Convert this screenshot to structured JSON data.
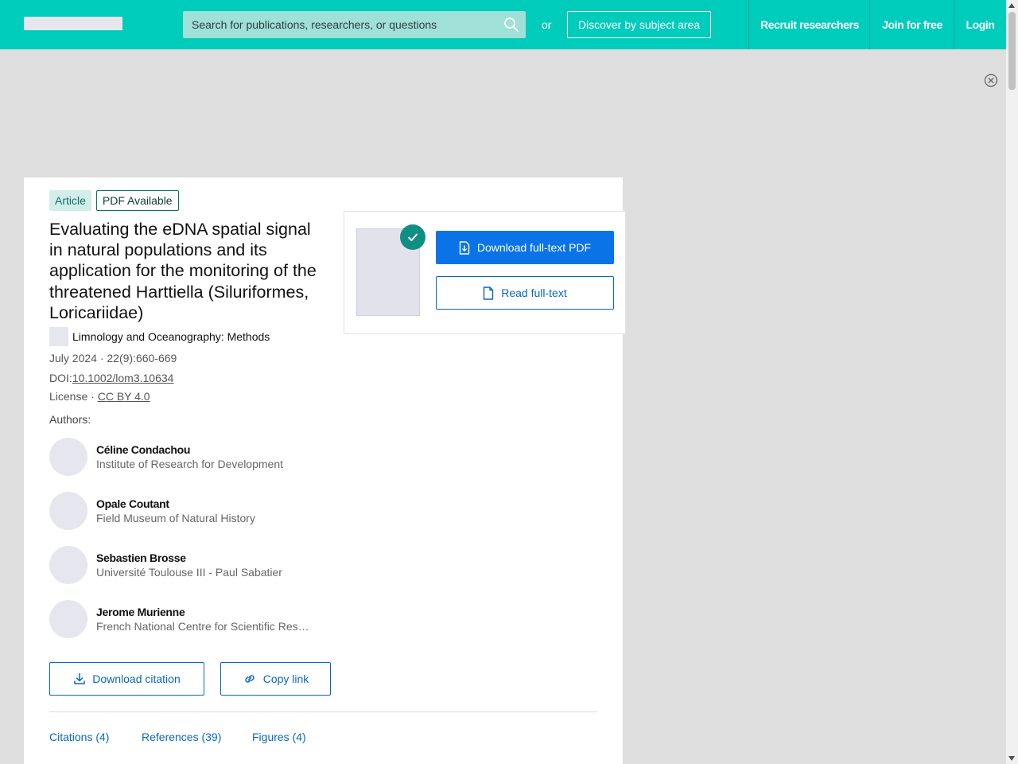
{
  "header": {
    "search_placeholder": "Search for publications, researchers, or questions",
    "or_text": "or",
    "discover_label": "Discover by subject area",
    "nav": {
      "recruit": "Recruit researchers",
      "join": "Join for free",
      "login": "Login"
    }
  },
  "article": {
    "badge_type": "Article",
    "badge_pdf": "PDF Available",
    "title": "Evaluating the eDNA spatial signal in natural populations and its application for the monitoring of the threatened Harttiella (Siluriformes, Loricariidae)",
    "journal": "Limnology and Oceanography: Methods",
    "date_volume": "July 2024 · 22(9):660-669",
    "doi_label": "DOI:",
    "doi": "10.1002/lom3.10634",
    "license_label": "License · ",
    "license": "CC BY 4.0",
    "authors_label": "Authors:",
    "authors": [
      {
        "name": "Céline Condachou",
        "affiliation": "Institute of Research for Development"
      },
      {
        "name": "Opale Coutant",
        "affiliation": "Field Museum of Natural History"
      },
      {
        "name": "Sebastien Brosse",
        "affiliation": "Université Toulouse III - Paul Sabatier"
      },
      {
        "name": "Jerome Murienne",
        "affiliation": "French National Centre for Scientific Rese..."
      }
    ],
    "actions": {
      "download_citation": "Download citation",
      "copy_link": "Copy link"
    },
    "tabs": {
      "citations": "Citations (4)",
      "references": "References (39)",
      "figures": "Figures (4)"
    }
  },
  "pdf_panel": {
    "download_label": "Download full-text PDF",
    "read_label": "Read full-text"
  },
  "colors": {
    "header_bg": "#00ccbb",
    "primary_blue": "#0a73e8",
    "teal_dark": "#0f8f83"
  }
}
